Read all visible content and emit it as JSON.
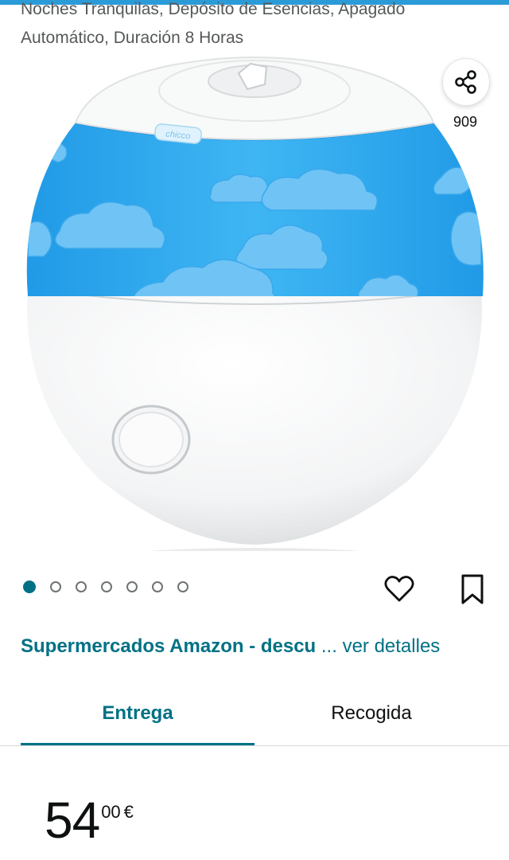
{
  "product": {
    "title": "Noches Tranquilas, Depósito de Esencias, Apagado Automático, Duración 8 Horas"
  },
  "share": {
    "icon": "share-icon",
    "count": "909"
  },
  "image": {
    "brand_mark": "chicco",
    "main_color": "#2aa9ee",
    "cloud_color": "#6fc4f5"
  },
  "carousel": {
    "total": 7,
    "active_index": 0
  },
  "actions": {
    "wishlist_icon": "heart-icon",
    "save_icon": "bookmark-icon"
  },
  "promo": {
    "text": "Supermercados Amazon - descu",
    "link": "... ver detalles"
  },
  "tabs": {
    "delivery": "Entrega",
    "pickup": "Recogida"
  },
  "price": {
    "whole": "54",
    "fraction": "00",
    "currency": "€"
  },
  "colors": {
    "accent": "#007185",
    "top_bar": "#2b9bd8"
  }
}
